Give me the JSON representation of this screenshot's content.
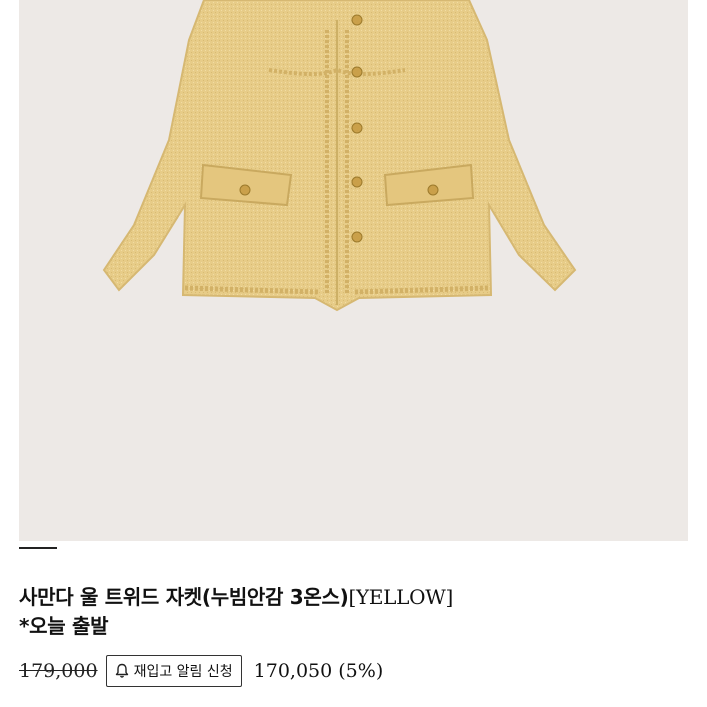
{
  "product": {
    "title_line1": "사만다 울 트위드 자켓(누빔안감 3온스)",
    "title_variant": "[YELLOW]",
    "title_line2": "*오늘 출발",
    "original_price": "179,000",
    "restock_label": "재입고 알림 신청",
    "sale_price": "170,050",
    "discount": "(5%)",
    "image_icon": "tweed-jacket-photo",
    "bell_icon": "bell-icon"
  },
  "colors": {
    "image_background": "#ede9e6",
    "jacket": "#e8cf8c"
  }
}
